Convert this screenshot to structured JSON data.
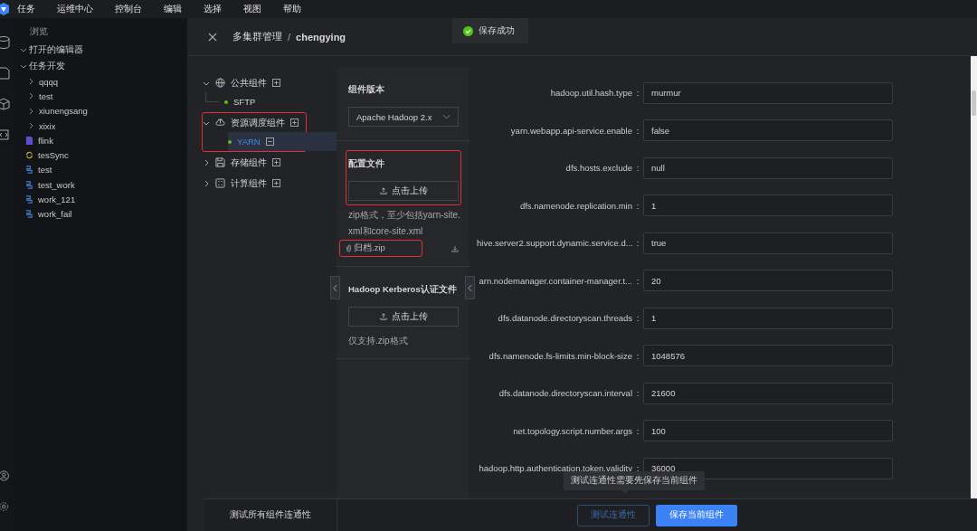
{
  "menu": {
    "items": [
      "任务",
      "运维中心",
      "控制台",
      "编辑",
      "选择",
      "视图",
      "帮助"
    ]
  },
  "sidebar": {
    "title": "浏览",
    "sections": [
      {
        "label": "打开的编辑器",
        "expanded": true
      },
      {
        "label": "任务开发",
        "expanded": true,
        "items": [
          {
            "label": "qqqq",
            "kind": "folder",
            "expanded": false
          },
          {
            "label": "test",
            "kind": "folder",
            "expanded": false
          },
          {
            "label": "xiunengsang",
            "kind": "folder",
            "expanded": false
          },
          {
            "label": "xixix",
            "kind": "folder",
            "expanded": false
          },
          {
            "label": "flink",
            "kind": "flink"
          },
          {
            "label": "tesSync",
            "kind": "sync"
          },
          {
            "label": "test",
            "kind": "workflow"
          },
          {
            "label": "test_work",
            "kind": "workflow"
          },
          {
            "label": "work_121",
            "kind": "workflow"
          },
          {
            "label": "work_fail",
            "kind": "workflow"
          }
        ]
      }
    ]
  },
  "panel": {
    "section": "多集群管理",
    "separator": "/",
    "cluster": "chengying"
  },
  "toast": {
    "kind": "success",
    "text": "保存成功"
  },
  "tree": [
    {
      "label": "公共组件",
      "kind": "common",
      "expanded": true,
      "highlighted": false,
      "children": [
        {
          "label": "SFTP",
          "color": "#52c41a",
          "selected": false
        }
      ]
    },
    {
      "label": "资源调度组件",
      "kind": "scheduler",
      "expanded": true,
      "highlighted": true,
      "children": [
        {
          "label": "YARN",
          "color": "#52c41a",
          "selected": true
        }
      ]
    },
    {
      "label": "存储组件",
      "kind": "storage",
      "expanded": false,
      "highlighted": false
    },
    {
      "label": "计算组件",
      "kind": "compute",
      "expanded": false,
      "highlighted": false
    }
  ],
  "config_sections": [
    {
      "kind": "select",
      "title": "组件版本",
      "value": "Apache Hadoop 2.x",
      "highlighted": false
    },
    {
      "kind": "upload",
      "title": "配置文件",
      "button": "点击上传",
      "highlighted": true,
      "hint": "zip格式，至少包括yarn-site.xml和core-site.xml",
      "file": {
        "name": "归档.zip",
        "highlighted": true
      }
    },
    {
      "kind": "upload",
      "title": "Hadoop Kerberos认证文件",
      "button": "点击上传",
      "highlighted": false,
      "hint": "仅支持.zip格式"
    }
  ],
  "fields": [
    {
      "label": "hadoop.util.hash.type",
      "colon": ":",
      "value": "murmur"
    },
    {
      "label": "yarn.webapp.api-service.enable",
      "colon": ":",
      "value": "false"
    },
    {
      "label": "dfs.hosts.exclude",
      "colon": ":",
      "value": "null"
    },
    {
      "label": "dfs.namenode.replication.min",
      "colon": ":",
      "value": "1"
    },
    {
      "label": "hive.server2.support.dynamic.service.d...",
      "colon": ":",
      "value": "true"
    },
    {
      "label": "arn.nodemanager.container-manager.t...",
      "colon": ":",
      "value": "20"
    },
    {
      "label": "dfs.datanode.directoryscan.threads",
      "colon": ":",
      "value": "1"
    },
    {
      "label": "dfs.namenode.fs-limits.min-block-size",
      "colon": ":",
      "value": "1048576"
    },
    {
      "label": "dfs.datanode.directoryscan.interval",
      "colon": ":",
      "value": "21600"
    },
    {
      "label": "net.topology.script.number.args",
      "colon": ":",
      "value": "100"
    },
    {
      "label": "hadoop.http.authentication.token.validity",
      "colon": ":",
      "value": "36000"
    }
  ],
  "footer": {
    "test_all": "测试所有组件连通性",
    "tooltip": "测试连通性需要先保存当前组件",
    "buttons": [
      {
        "label": "测试连通性",
        "kind": "outline"
      },
      {
        "label": "保存当前组件",
        "kind": "primary"
      }
    ]
  }
}
